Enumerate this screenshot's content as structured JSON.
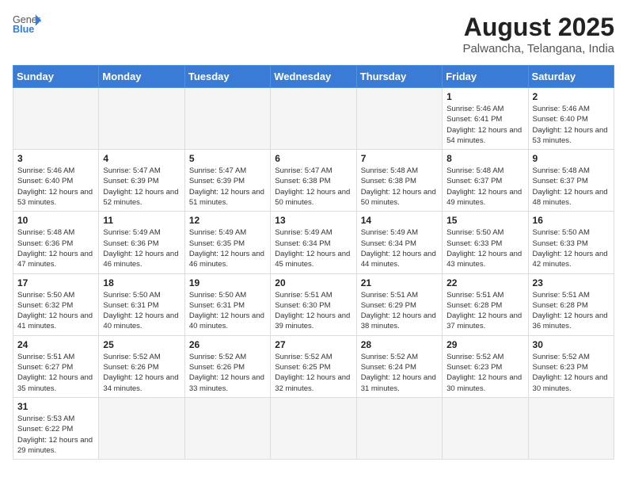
{
  "header": {
    "logo_general": "General",
    "logo_blue": "Blue",
    "month_year": "August 2025",
    "location": "Palwancha, Telangana, India"
  },
  "days_of_week": [
    "Sunday",
    "Monday",
    "Tuesday",
    "Wednesday",
    "Thursday",
    "Friday",
    "Saturday"
  ],
  "weeks": [
    [
      {
        "day": "",
        "info": ""
      },
      {
        "day": "",
        "info": ""
      },
      {
        "day": "",
        "info": ""
      },
      {
        "day": "",
        "info": ""
      },
      {
        "day": "",
        "info": ""
      },
      {
        "day": "1",
        "info": "Sunrise: 5:46 AM\nSunset: 6:41 PM\nDaylight: 12 hours\nand 54 minutes."
      },
      {
        "day": "2",
        "info": "Sunrise: 5:46 AM\nSunset: 6:40 PM\nDaylight: 12 hours\nand 53 minutes."
      }
    ],
    [
      {
        "day": "3",
        "info": "Sunrise: 5:46 AM\nSunset: 6:40 PM\nDaylight: 12 hours\nand 53 minutes."
      },
      {
        "day": "4",
        "info": "Sunrise: 5:47 AM\nSunset: 6:39 PM\nDaylight: 12 hours\nand 52 minutes."
      },
      {
        "day": "5",
        "info": "Sunrise: 5:47 AM\nSunset: 6:39 PM\nDaylight: 12 hours\nand 51 minutes."
      },
      {
        "day": "6",
        "info": "Sunrise: 5:47 AM\nSunset: 6:38 PM\nDaylight: 12 hours\nand 50 minutes."
      },
      {
        "day": "7",
        "info": "Sunrise: 5:48 AM\nSunset: 6:38 PM\nDaylight: 12 hours\nand 50 minutes."
      },
      {
        "day": "8",
        "info": "Sunrise: 5:48 AM\nSunset: 6:37 PM\nDaylight: 12 hours\nand 49 minutes."
      },
      {
        "day": "9",
        "info": "Sunrise: 5:48 AM\nSunset: 6:37 PM\nDaylight: 12 hours\nand 48 minutes."
      }
    ],
    [
      {
        "day": "10",
        "info": "Sunrise: 5:48 AM\nSunset: 6:36 PM\nDaylight: 12 hours\nand 47 minutes."
      },
      {
        "day": "11",
        "info": "Sunrise: 5:49 AM\nSunset: 6:36 PM\nDaylight: 12 hours\nand 46 minutes."
      },
      {
        "day": "12",
        "info": "Sunrise: 5:49 AM\nSunset: 6:35 PM\nDaylight: 12 hours\nand 46 minutes."
      },
      {
        "day": "13",
        "info": "Sunrise: 5:49 AM\nSunset: 6:34 PM\nDaylight: 12 hours\nand 45 minutes."
      },
      {
        "day": "14",
        "info": "Sunrise: 5:49 AM\nSunset: 6:34 PM\nDaylight: 12 hours\nand 44 minutes."
      },
      {
        "day": "15",
        "info": "Sunrise: 5:50 AM\nSunset: 6:33 PM\nDaylight: 12 hours\nand 43 minutes."
      },
      {
        "day": "16",
        "info": "Sunrise: 5:50 AM\nSunset: 6:33 PM\nDaylight: 12 hours\nand 42 minutes."
      }
    ],
    [
      {
        "day": "17",
        "info": "Sunrise: 5:50 AM\nSunset: 6:32 PM\nDaylight: 12 hours\nand 41 minutes."
      },
      {
        "day": "18",
        "info": "Sunrise: 5:50 AM\nSunset: 6:31 PM\nDaylight: 12 hours\nand 40 minutes."
      },
      {
        "day": "19",
        "info": "Sunrise: 5:50 AM\nSunset: 6:31 PM\nDaylight: 12 hours\nand 40 minutes."
      },
      {
        "day": "20",
        "info": "Sunrise: 5:51 AM\nSunset: 6:30 PM\nDaylight: 12 hours\nand 39 minutes."
      },
      {
        "day": "21",
        "info": "Sunrise: 5:51 AM\nSunset: 6:29 PM\nDaylight: 12 hours\nand 38 minutes."
      },
      {
        "day": "22",
        "info": "Sunrise: 5:51 AM\nSunset: 6:28 PM\nDaylight: 12 hours\nand 37 minutes."
      },
      {
        "day": "23",
        "info": "Sunrise: 5:51 AM\nSunset: 6:28 PM\nDaylight: 12 hours\nand 36 minutes."
      }
    ],
    [
      {
        "day": "24",
        "info": "Sunrise: 5:51 AM\nSunset: 6:27 PM\nDaylight: 12 hours\nand 35 minutes."
      },
      {
        "day": "25",
        "info": "Sunrise: 5:52 AM\nSunset: 6:26 PM\nDaylight: 12 hours\nand 34 minutes."
      },
      {
        "day": "26",
        "info": "Sunrise: 5:52 AM\nSunset: 6:26 PM\nDaylight: 12 hours\nand 33 minutes."
      },
      {
        "day": "27",
        "info": "Sunrise: 5:52 AM\nSunset: 6:25 PM\nDaylight: 12 hours\nand 32 minutes."
      },
      {
        "day": "28",
        "info": "Sunrise: 5:52 AM\nSunset: 6:24 PM\nDaylight: 12 hours\nand 31 minutes."
      },
      {
        "day": "29",
        "info": "Sunrise: 5:52 AM\nSunset: 6:23 PM\nDaylight: 12 hours\nand 30 minutes."
      },
      {
        "day": "30",
        "info": "Sunrise: 5:52 AM\nSunset: 6:23 PM\nDaylight: 12 hours\nand 30 minutes."
      }
    ],
    [
      {
        "day": "31",
        "info": "Sunrise: 5:53 AM\nSunset: 6:22 PM\nDaylight: 12 hours\nand 29 minutes."
      },
      {
        "day": "",
        "info": ""
      },
      {
        "day": "",
        "info": ""
      },
      {
        "day": "",
        "info": ""
      },
      {
        "day": "",
        "info": ""
      },
      {
        "day": "",
        "info": ""
      },
      {
        "day": "",
        "info": ""
      }
    ]
  ]
}
